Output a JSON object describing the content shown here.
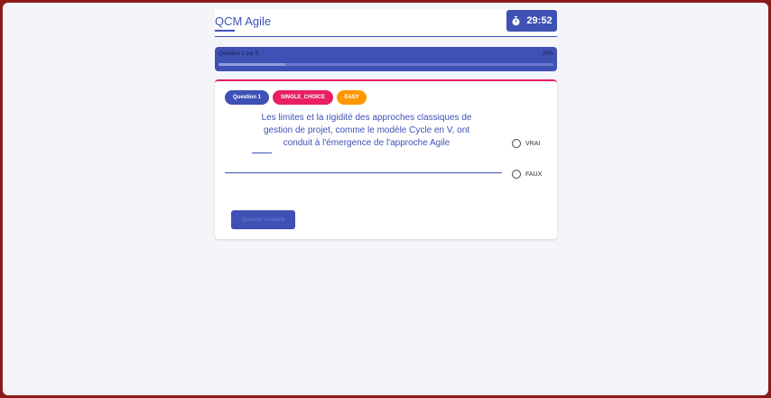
{
  "header": {
    "title": "QCM Agile",
    "timer": "29:52",
    "timer_icon": "stopwatch-icon"
  },
  "progress": {
    "label": "Question 1 sur 5",
    "percent_text": "20%",
    "fraction": 0.2
  },
  "question": {
    "chips": {
      "number": "Question 1",
      "type": "SINGLE_CHOICE",
      "level": "EASY"
    },
    "text": "Les limites et la rigidité des approches classiques de gestion de projet, comme le modèle Cycle en V, ont conduit à l'émergence de l'approche Agile",
    "options": [
      {
        "label": "VRAI"
      },
      {
        "label": "FAUX"
      }
    ],
    "next_label": "Question suivante"
  },
  "colors": {
    "primary": "#3f51b5",
    "accent": "#e91e63",
    "warning": "#ff9800",
    "background": "#f4f5f9"
  }
}
